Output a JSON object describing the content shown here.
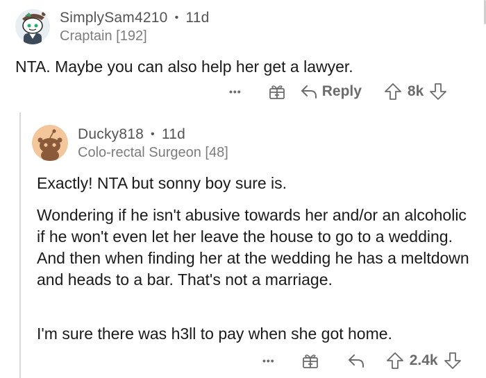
{
  "comment1": {
    "username": "SimplySam4210",
    "separator": "•",
    "age": "11d",
    "flair": "Craptain [192]",
    "body": "NTA.  Maybe you can also help her get a lawyer.",
    "more_label": "•••",
    "reply_label": "Reply",
    "votes": "8k"
  },
  "comment2": {
    "username": "Ducky818",
    "separator": "•",
    "age": "11d",
    "flair": "Colo-rectal Surgeon [48]",
    "paragraphs": [
      "Exactly!  NTA but sonny boy sure is.",
      "Wondering if he isn't abusive  towards her and/or an alcoholic if he won't even let her leave the house to go to a wedding.  And then when finding her at the wedding he has a meltdown and heads to a bar.  That's not a marriage.",
      "I'm sure there was h3ll to pay when she got home."
    ],
    "more_label": "•••",
    "votes": "2.4k"
  },
  "icons": {
    "avatar1": "snoo-avatar-with-hat",
    "avatar2": "snoo-avatar-tan",
    "award": "gift-award-icon",
    "reply": "reply-arrow-icon",
    "upvote": "upvote-arrow-icon",
    "downvote": "downvote-arrow-icon"
  },
  "colors": {
    "text": "#1a1a1b",
    "meta": "#7c7c7c",
    "action": "#6b6b6b",
    "avatar2_bg": "#f3c69b"
  }
}
